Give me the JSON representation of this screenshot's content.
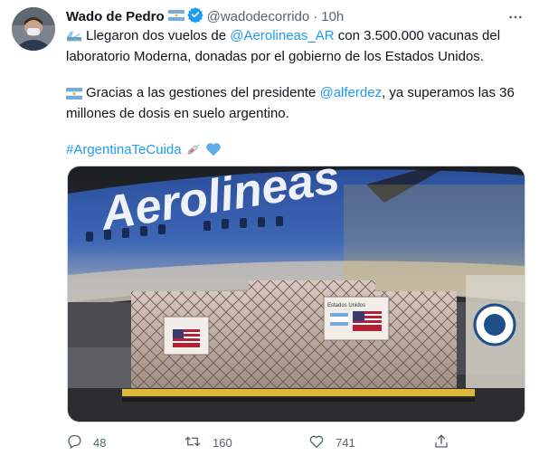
{
  "tweet": {
    "author": {
      "display_name": "Wado de Pedro",
      "handle": "@wadodecorrido",
      "verified": true,
      "time": "10h",
      "separator": "·"
    },
    "paragraph1": {
      "before": "Llegaron dos vuelos de ",
      "mention": "@Aerolineas_AR",
      "after": " con 3.500.000 vacunas del laboratorio Moderna, donadas por el gobierno de los Estados Unidos."
    },
    "paragraph2": {
      "before": "Gracias a las gestiones del presidente ",
      "mention": "@alferdez",
      "after": ", ya superamos las 36 millones de dosis en suelo argentino."
    },
    "paragraph3": {
      "hashtag": "#ArgentinaTeCuida"
    },
    "media": {
      "livery_text": "Aerolineas",
      "crate_label": "Estados Unidos"
    },
    "actions": {
      "replies": "48",
      "retweets": "160",
      "likes": "741"
    }
  },
  "colors": {
    "link": "#1d9bf0",
    "text": "#0f1419",
    "muted": "#536471",
    "verified": "#1d9bf0"
  }
}
